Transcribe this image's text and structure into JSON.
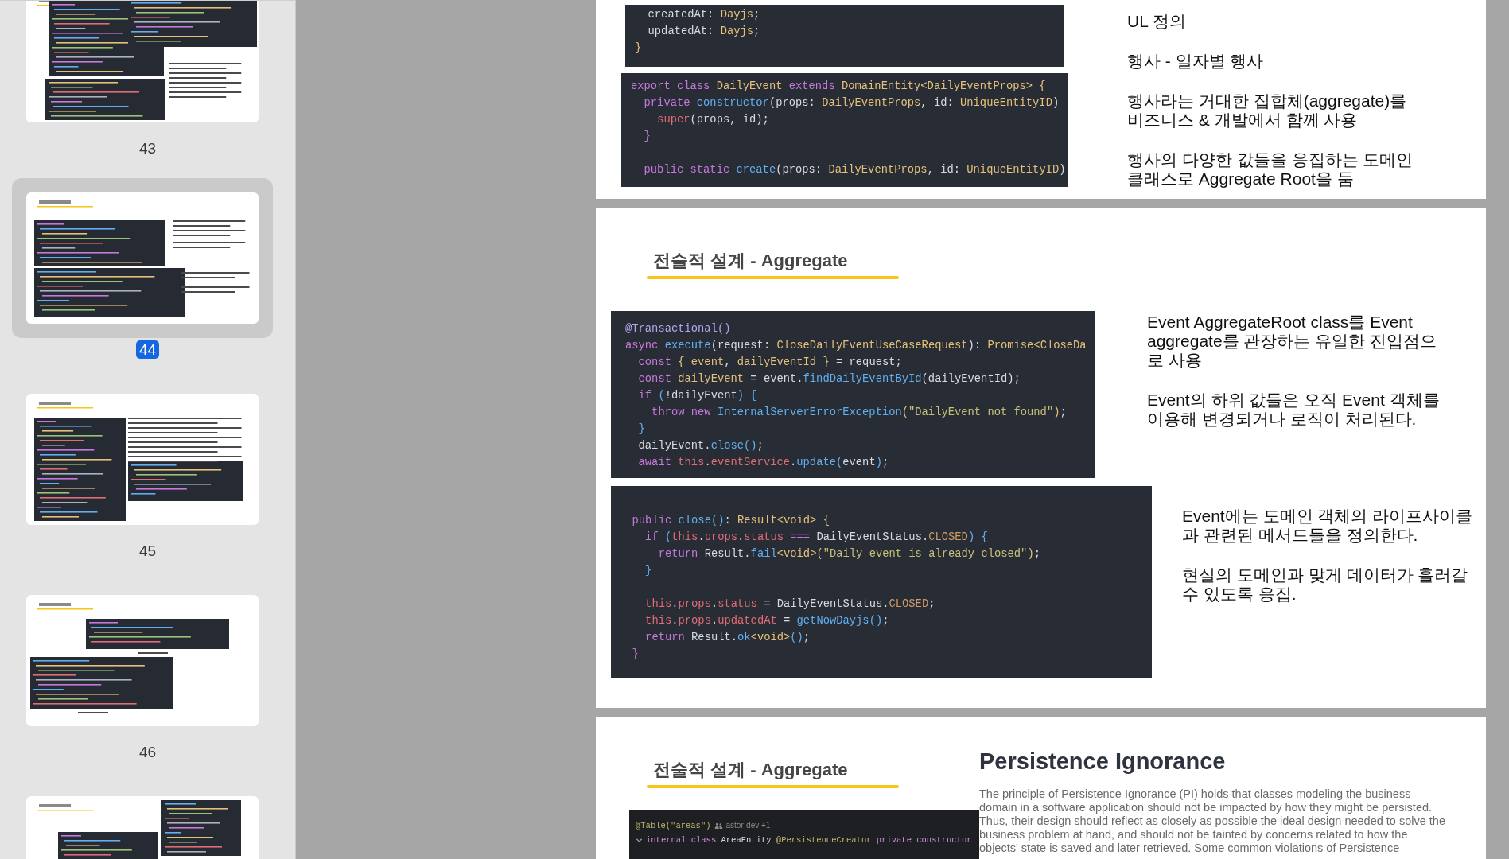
{
  "sidebar": {
    "thumbnails": [
      {
        "number": "43",
        "selected": false
      },
      {
        "number": "44",
        "selected": true
      },
      {
        "number": "45",
        "selected": false
      },
      {
        "number": "46",
        "selected": false
      },
      {
        "selected": false
      }
    ]
  },
  "pages": [
    {
      "kind": "code-notes",
      "code_blocks": [
        {
          "lines": [
            {
              "kind": "code",
              "tokens": [
                {
                  "kind": "p",
                  "text": "  createdAt: "
                },
                {
                  "kind": "t",
                  "text": "Dayjs"
                },
                {
                  "kind": "p",
                  "text": ";"
                }
              ]
            },
            {
              "kind": "code",
              "tokens": [
                {
                  "kind": "p",
                  "text": "  updatedAt: "
                },
                {
                  "kind": "t",
                  "text": "Dayjs"
                },
                {
                  "kind": "p",
                  "text": ";"
                }
              ]
            },
            {
              "kind": "code",
              "tokens": [
                {
                  "kind": "t",
                  "text": "}"
                }
              ]
            }
          ]
        },
        {
          "lines": [
            {
              "kind": "code",
              "tokens": [
                {
                  "kind": "k",
                  "text": "export class "
                },
                {
                  "kind": "t",
                  "text": "DailyEvent "
                },
                {
                  "kind": "k",
                  "text": "extends "
                },
                {
                  "kind": "t",
                  "text": "DomainEntity<DailyEventProps> {"
                }
              ]
            },
            {
              "kind": "code",
              "tokens": [
                {
                  "kind": "k",
                  "text": "  private "
                },
                {
                  "kind": "f",
                  "text": "constructor"
                },
                {
                  "kind": "p",
                  "text": "(props: "
                },
                {
                  "kind": "t",
                  "text": "DailyEventProps"
                },
                {
                  "kind": "p",
                  "text": ", id: "
                },
                {
                  "kind": "t",
                  "text": "UniqueEntityID"
                },
                {
                  "kind": "p",
                  "text": ")"
                }
              ]
            },
            {
              "kind": "code",
              "tokens": [
                {
                  "kind": "r",
                  "text": "    super"
                },
                {
                  "kind": "p",
                  "text": "(props, id);"
                }
              ]
            },
            {
              "kind": "code",
              "tokens": [
                {
                  "kind": "k",
                  "text": "  }"
                }
              ]
            },
            {
              "kind": "blank"
            },
            {
              "kind": "code",
              "tokens": [
                {
                  "kind": "k",
                  "text": "  public static "
                },
                {
                  "kind": "f",
                  "text": "create"
                },
                {
                  "kind": "p",
                  "text": "(props: "
                },
                {
                  "kind": "t",
                  "text": "DailyEventProps"
                },
                {
                  "kind": "p",
                  "text": ", id: "
                },
                {
                  "kind": "t",
                  "text": "UniqueEntityID"
                },
                {
                  "kind": "p",
                  "text": ")"
                }
              ]
            }
          ]
        }
      ],
      "notes": [
        "UL 정의",
        "행사 - 일자별 행사",
        "행사라는 거대한 집합체(aggregate)를 비즈니스 & 개발에서 함께 사용",
        "행사의 다양한 값들을 응집하는 도메인 클래스로 Aggregate Root을 둠"
      ]
    },
    {
      "kind": "rows",
      "title": "전술적 설계 - Aggregate",
      "rows": [
        {
          "code": {
            "lines": [
              {
                "kind": "code",
                "tokens": [
                  {
                    "kind": "d",
                    "text": "@Transactional()"
                  }
                ]
              },
              {
                "kind": "code",
                "tokens": [
                  {
                    "kind": "k",
                    "text": "async "
                  },
                  {
                    "kind": "f",
                    "text": "execute"
                  },
                  {
                    "kind": "p",
                    "text": "(request: "
                  },
                  {
                    "kind": "t",
                    "text": "CloseDailyEventUseCaseRequest"
                  },
                  {
                    "kind": "p",
                    "text": "): "
                  },
                  {
                    "kind": "t",
                    "text": "Promise<CloseDa"
                  }
                ]
              },
              {
                "kind": "code",
                "tokens": [
                  {
                    "kind": "k",
                    "text": "  const "
                  },
                  {
                    "kind": "t",
                    "text": "{ event"
                  },
                  {
                    "kind": "p",
                    "text": ", "
                  },
                  {
                    "kind": "t",
                    "text": "dailyEventId }"
                  },
                  {
                    "kind": "p",
                    "text": " = request;"
                  }
                ]
              },
              {
                "kind": "code",
                "tokens": [
                  {
                    "kind": "k",
                    "text": "  const "
                  },
                  {
                    "kind": "t",
                    "text": "dailyEvent"
                  },
                  {
                    "kind": "p",
                    "text": " = event."
                  },
                  {
                    "kind": "f",
                    "text": "findDailyEventById"
                  },
                  {
                    "kind": "p",
                    "text": "(dailyEventId);"
                  }
                ]
              },
              {
                "kind": "code",
                "tokens": [
                  {
                    "kind": "k",
                    "text": "  if "
                  },
                  {
                    "kind": "f",
                    "text": "("
                  },
                  {
                    "kind": "p",
                    "text": "!dailyEvent"
                  },
                  {
                    "kind": "f",
                    "text": ") {"
                  }
                ]
              },
              {
                "kind": "code",
                "tokens": [
                  {
                    "kind": "k",
                    "text": "    throw new "
                  },
                  {
                    "kind": "f",
                    "text": "InternalServerErrorException"
                  },
                  {
                    "kind": "t",
                    "text": "("
                  },
                  {
                    "kind": "s",
                    "text": "\"DailyEvent not found\""
                  },
                  {
                    "kind": "t",
                    "text": ")"
                  },
                  {
                    "kind": "p",
                    "text": ";"
                  }
                ]
              },
              {
                "kind": "code",
                "tokens": [
                  {
                    "kind": "f",
                    "text": "  }"
                  }
                ]
              },
              {
                "kind": "code",
                "tokens": [
                  {
                    "kind": "p",
                    "text": "  dailyEvent."
                  },
                  {
                    "kind": "f",
                    "text": "close()"
                  },
                  {
                    "kind": "p",
                    "text": ";"
                  }
                ]
              },
              {
                "kind": "code",
                "tokens": [
                  {
                    "kind": "k",
                    "text": "  await "
                  },
                  {
                    "kind": "r",
                    "text": "this"
                  },
                  {
                    "kind": "p",
                    "text": "."
                  },
                  {
                    "kind": "r",
                    "text": "eventService"
                  },
                  {
                    "kind": "p",
                    "text": "."
                  },
                  {
                    "kind": "f",
                    "text": "update("
                  },
                  {
                    "kind": "p",
                    "text": "event"
                  },
                  {
                    "kind": "f",
                    "text": ")"
                  },
                  {
                    "kind": "p",
                    "text": ";"
                  }
                ]
              }
            ]
          },
          "notes": [
            "Event AggregateRoot class를 Event aggregate를 관장하는 유일한 진입점으로 사용",
            "Event의 하위 값들은 오직 Event 객체를 이용해 변경되거나 로직이 처리된다."
          ]
        },
        {
          "code": {
            "lines": [
              {
                "kind": "blank"
              },
              {
                "kind": "code",
                "tokens": [
                  {
                    "kind": "k",
                    "text": "  public "
                  },
                  {
                    "kind": "f",
                    "text": "close()"
                  },
                  {
                    "kind": "p",
                    "text": ": "
                  },
                  {
                    "kind": "t",
                    "text": "Result<void> {"
                  }
                ]
              },
              {
                "kind": "code",
                "tokens": [
                  {
                    "kind": "k",
                    "text": "    if "
                  },
                  {
                    "kind": "f",
                    "text": "("
                  },
                  {
                    "kind": "r",
                    "text": "this"
                  },
                  {
                    "kind": "p",
                    "text": "."
                  },
                  {
                    "kind": "r",
                    "text": "props"
                  },
                  {
                    "kind": "p",
                    "text": "."
                  },
                  {
                    "kind": "r",
                    "text": "status"
                  },
                  {
                    "kind": "k",
                    "text": " === "
                  },
                  {
                    "kind": "p",
                    "text": "DailyEventStatus."
                  },
                  {
                    "kind": "o",
                    "text": "CLOSED"
                  },
                  {
                    "kind": "f",
                    "text": ") {"
                  }
                ]
              },
              {
                "kind": "code",
                "tokens": [
                  {
                    "kind": "k",
                    "text": "      return "
                  },
                  {
                    "kind": "p",
                    "text": "Result."
                  },
                  {
                    "kind": "f",
                    "text": "fail"
                  },
                  {
                    "kind": "t",
                    "text": "<void>("
                  },
                  {
                    "kind": "s",
                    "text": "\"Daily event is already closed\""
                  },
                  {
                    "kind": "t",
                    "text": ")"
                  },
                  {
                    "kind": "p",
                    "text": ";"
                  }
                ]
              },
              {
                "kind": "code",
                "tokens": [
                  {
                    "kind": "f",
                    "text": "    }"
                  }
                ]
              },
              {
                "kind": "blank"
              },
              {
                "kind": "code",
                "tokens": [
                  {
                    "kind": "r",
                    "text": "    this"
                  },
                  {
                    "kind": "p",
                    "text": "."
                  },
                  {
                    "kind": "r",
                    "text": "props"
                  },
                  {
                    "kind": "p",
                    "text": "."
                  },
                  {
                    "kind": "r",
                    "text": "status"
                  },
                  {
                    "kind": "p",
                    "text": " = DailyEventStatus."
                  },
                  {
                    "kind": "o",
                    "text": "CLOSED"
                  },
                  {
                    "kind": "p",
                    "text": ";"
                  }
                ]
              },
              {
                "kind": "code",
                "tokens": [
                  {
                    "kind": "r",
                    "text": "    this"
                  },
                  {
                    "kind": "p",
                    "text": "."
                  },
                  {
                    "kind": "r",
                    "text": "props"
                  },
                  {
                    "kind": "p",
                    "text": "."
                  },
                  {
                    "kind": "r",
                    "text": "updatedAt"
                  },
                  {
                    "kind": "p",
                    "text": " = "
                  },
                  {
                    "kind": "f",
                    "text": "getNowDayjs()"
                  },
                  {
                    "kind": "p",
                    "text": ";"
                  }
                ]
              },
              {
                "kind": "code",
                "tokens": [
                  {
                    "kind": "k",
                    "text": "    return "
                  },
                  {
                    "kind": "p",
                    "text": "Result."
                  },
                  {
                    "kind": "f",
                    "text": "ok"
                  },
                  {
                    "kind": "t",
                    "text": "<void>"
                  },
                  {
                    "kind": "f",
                    "text": "()"
                  },
                  {
                    "kind": "p",
                    "text": ";"
                  }
                ]
              },
              {
                "kind": "code",
                "tokens": [
                  {
                    "kind": "k",
                    "text": "  }"
                  }
                ]
              }
            ]
          },
          "notes": [
            "Event에는 도메인 객체의 라이프사이클과 관련된 메서드들을 정의한다.",
            "현실의 도메인과 맞게 데이터가 흘러갈 수 있도록 응집."
          ]
        }
      ]
    },
    {
      "kind": "article",
      "title": "전술적 설계 - Aggregate",
      "code": {
        "lines": [
          {
            "kind": "code",
            "tokens": [
              {
                "kind": "y",
                "text": "@Table(\"areas\")"
              }
            ],
            "annotation": "astor-dev +1"
          },
          {
            "kind": "code",
            "fold": true,
            "tokens": [
              {
                "kind": "m",
                "text": "internal class "
              },
              {
                "kind": "p",
                "text": "AreaEntity "
              },
              {
                "kind": "y",
                "text": "@PersistenceCreator "
              },
              {
                "kind": "m",
                "text": "private constructor"
              }
            ]
          }
        ]
      },
      "heading": "Persistence Ignorance",
      "paragraph": "The principle of Persistence Ignorance (PI) holds that classes modeling the business domain in a software application should not be impacted by how they might be persisted. Thus, their design should reflect as closely as possible the ideal design needed to solve the business problem at hand, and should not be tainted by concerns related to how the objects' state is saved and later retrieved. Some common violations of Persistence"
    }
  ]
}
